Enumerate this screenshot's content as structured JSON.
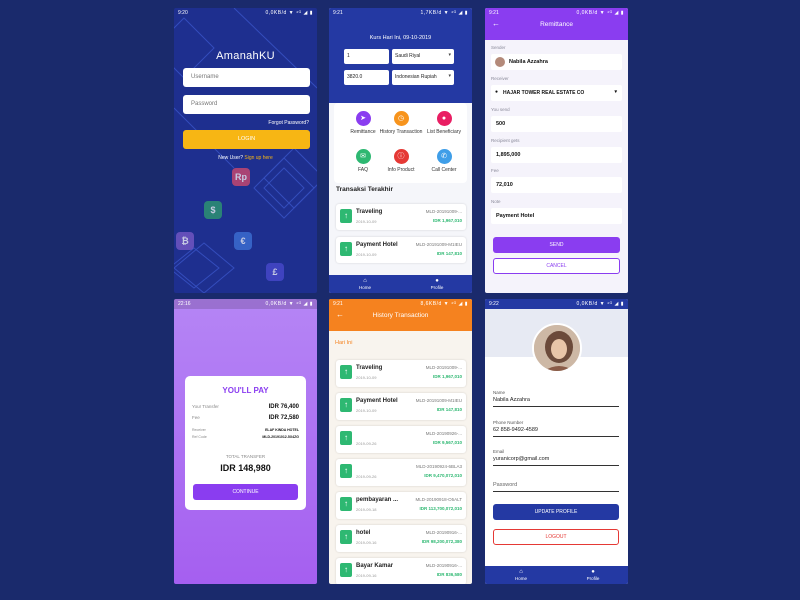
{
  "login": {
    "status_time": "9:20",
    "status_right": "0,0KB/d ▼ ⁴ᴳ ◢ ▮",
    "app_title": "AmanahKU",
    "username_placeholder": "Username",
    "password_placeholder": "Password",
    "forgot": "Forgot Password?",
    "login_button": "LOGIN",
    "new_user": "New User?",
    "signup": "Sign up here",
    "currency_icons": [
      "Rp",
      "$",
      "€",
      "£",
      "₿"
    ]
  },
  "home": {
    "status_time": "9:21",
    "status_right": "1,7KB/d ▼ ⁴ᴳ ◢ ▮",
    "kurs": "Kurs Hari Ini, 09-10-2019",
    "from_value": "1",
    "from_currency": "Saudi Riyal",
    "to_value": "3820.0",
    "to_currency": "Indonesian Rupiah",
    "menu": [
      {
        "label": "Remittance",
        "color": "#8a3df0",
        "icon": "send-icon",
        "glyph": "➤"
      },
      {
        "label": "History Transaction",
        "color": "#f7941d",
        "icon": "history-icon",
        "glyph": "◷"
      },
      {
        "label": "List Beneficiary",
        "color": "#e91e63",
        "icon": "person-icon",
        "glyph": "●"
      },
      {
        "label": "FAQ",
        "color": "#2eb872",
        "icon": "chat-icon",
        "glyph": "✉"
      },
      {
        "label": "Info Product",
        "color": "#e53935",
        "icon": "info-icon",
        "glyph": "ⓘ"
      },
      {
        "label": "Call Center",
        "color": "#3f9ee8",
        "icon": "phone-icon",
        "glyph": "✆"
      }
    ],
    "section_title": "Transaksi Terakhir",
    "transactions": [
      {
        "name": "Traveling",
        "date": "2019-10-09",
        "id": "MLD-20191009-...",
        "amount": "IDR 1,967,010"
      },
      {
        "name": "Payment Hotel",
        "date": "2019-10-09",
        "id": "MLD-20191009-M1IEU",
        "amount": "IDR 147,810"
      }
    ],
    "nav": {
      "home": "Home",
      "profile": "Profile"
    }
  },
  "remittance": {
    "status_time": "9:21",
    "status_right": "0,0KB/d ▼ ⁴ᴳ ◢ ▮",
    "title": "Remittance",
    "sender_label": "Sender",
    "sender": "Nabila Azzahra",
    "receiver_label": "Receiver",
    "receiver": "HAJAR TOWER REAL ESTATE CO",
    "you_send_label": "You send",
    "you_send": "500",
    "recipient_label": "Recipient gets",
    "recipient": "1,895,000",
    "fee_label": "Fee",
    "fee": "72,010",
    "note_label": "Note",
    "note": "Payment Hotel",
    "send_button": "SEND",
    "cancel_button": "CANCEL"
  },
  "pay": {
    "status_time": "22:16",
    "status_right": "0,0KB/d ▼ ⁴ᴳ ◢ ▮",
    "title": "YOU'LL PAY",
    "rows": [
      {
        "label": "Your Transfer",
        "value": "IDR 76,400"
      },
      {
        "label": "Fee",
        "value": "IDR 72,580"
      },
      {
        "label": "Receiver",
        "value": "ELAF KINDA HOTEL"
      },
      {
        "label": "Ref Code",
        "value": "MLD-20191012-5X4ZG"
      }
    ],
    "total_label": "TOTAL TRANSFER",
    "total_value": "IDR 148,980",
    "continue_button": "CONTINUE"
  },
  "history": {
    "status_time": "9:21",
    "status_right": "8,6KB/d ▼ ⁴ᴳ ◢ ▮",
    "title": "History Transaction",
    "section": "Hari Ini",
    "items": [
      {
        "name": "Traveling",
        "date": "2019-10-09",
        "id": "MLD-20191009-...",
        "amount": "IDR 1,967,010"
      },
      {
        "name": "Payment Hotel",
        "date": "2019-10-09",
        "id": "MLD-20191009-M1IEU",
        "amount": "IDR 147,810"
      },
      {
        "name": "",
        "date": "2019-09-26",
        "id": "MLD-20190926-...",
        "amount": "IDR 9,567,010"
      },
      {
        "name": "",
        "date": "2019-09-26",
        "id": "MLD-20190924-6BLA3",
        "amount": "IDR 9,470,072,010"
      },
      {
        "name": "pembayaran ...",
        "date": "2019-09-18",
        "id": "MLD-20190918-O5ALT",
        "amount": "IDR 113,700,072,010"
      },
      {
        "name": "hotel",
        "date": "2019-09-16",
        "id": "MLD-20190916-...",
        "amount": "IDR 98,200,072,380"
      },
      {
        "name": "Bayar Kamar",
        "date": "2019-09-16",
        "id": "MLD-20190916-...",
        "amount": "IDR 836,580"
      }
    ]
  },
  "profile": {
    "status_time": "9:22",
    "status_right": "0,0KB/d ▼ ⁴ᴳ ◢ ▮",
    "name_label": "Name",
    "name": "Nabila Azzahra",
    "phone_label": "Phone Number",
    "phone": "62 858-9492-4589",
    "email_label": "Email",
    "email": "yuranicorp@gmail.com",
    "password_placeholder": "Password",
    "update_button": "UPDATE PROFILE",
    "logout_button": "LOGOUT",
    "nav": {
      "home": "Home",
      "profile": "Profile"
    }
  }
}
